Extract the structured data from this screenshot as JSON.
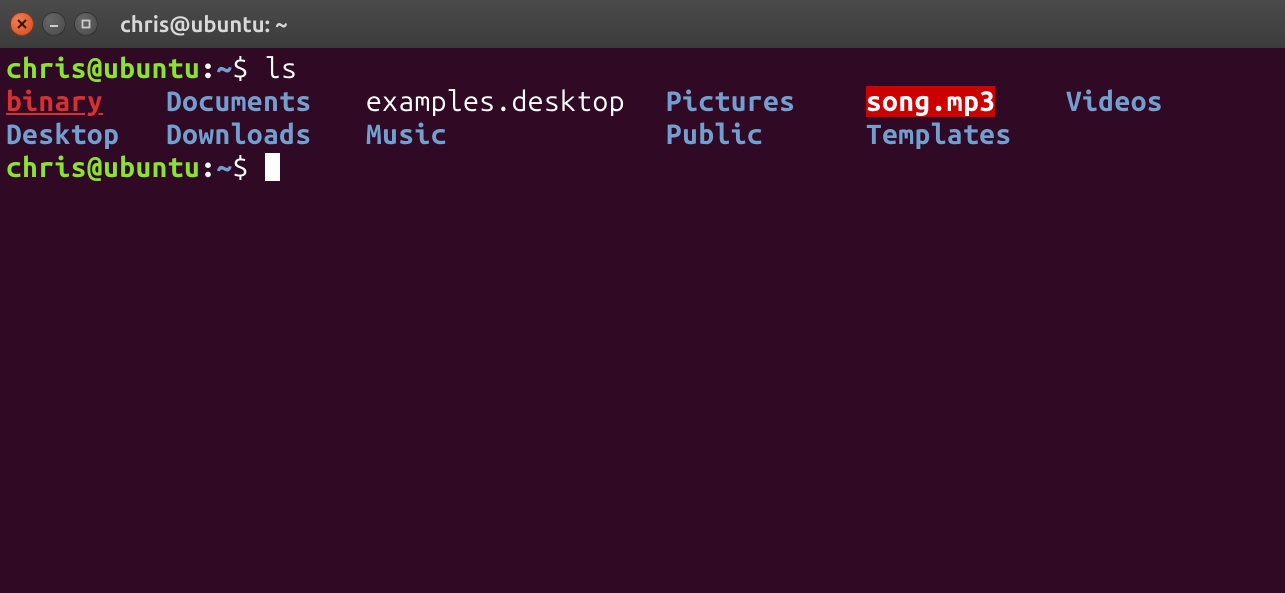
{
  "window": {
    "title": "chris@ubuntu: ~"
  },
  "prompt": {
    "user_host": "chris@ubuntu",
    "colon": ":",
    "path": "~",
    "dollar": "$"
  },
  "command": {
    "text": "ls"
  },
  "listing": {
    "row1": {
      "c1": "binary",
      "c2": "Documents",
      "c3": "examples.desktop",
      "c4": "Pictures",
      "c5": "song.mp3",
      "c6": "Videos"
    },
    "row2": {
      "c1": "Desktop",
      "c2": "Downloads",
      "c3": "Music",
      "c4": "Public",
      "c5": "Templates"
    }
  }
}
